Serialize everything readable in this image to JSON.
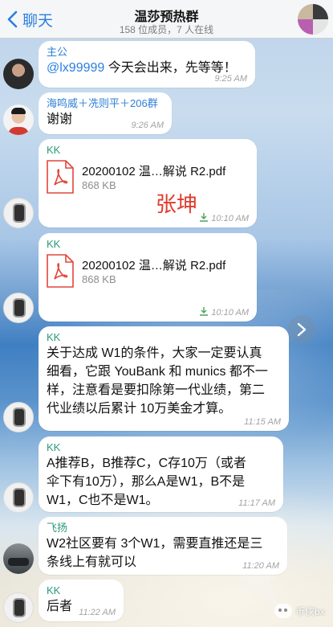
{
  "header": {
    "back_label": "聊天",
    "title": "温莎预热群",
    "subtitle": "158 位成员，7 人在线"
  },
  "messages": [
    {
      "sender": "主公",
      "mention": "@lx99999",
      "text": " 今天会出来，先等等！",
      "time": "9:25 AM"
    },
    {
      "sender": "海鸣威＋冼则平＋206群",
      "text": "谢谢",
      "time": "9:26 AM"
    },
    {
      "sender": "KK",
      "file_name": "20200102 温…解说 R2.pdf",
      "file_size": "868 KB",
      "time": "10:10 AM"
    },
    {
      "sender": "KK",
      "file_name": "20200102 温…解说 R2.pdf",
      "file_size": "868 KB",
      "time": "10:10 AM"
    },
    {
      "sender": "KK",
      "lines": [
        "关于达成 W1的条件，大家一定要认真",
        "细看，它跟 YouBank 和 munics 都不一",
        "样，注意看是要扣除第一代业绩，第二",
        "代业绩以后累计 10万美金才算。"
      ],
      "time": "11:15 AM"
    },
    {
      "sender": "KK",
      "lines": [
        "A推荐B，B推荐C，C存10万（或者",
        "伞下有10万），那么A是W1，B不是",
        "W1，C也不是W1。"
      ],
      "time": "11:17 AM"
    },
    {
      "sender": "飞扬",
      "lines": [
        "W2社区要有 3个W1，需要直推还是三",
        "条线上有就可以"
      ],
      "time": "11:20 AM"
    },
    {
      "sender": "KK",
      "text": "后者",
      "time": "11:22 AM"
    }
  ],
  "overlay": {
    "watermark_name": "张坤",
    "wechat_tag": "币侠bx"
  },
  "colors": {
    "accent": "#2a7fe0",
    "pdf_red": "#e0463a",
    "bubble": "#ffffff"
  },
  "icons": {
    "back": "chevron-left-icon",
    "file": "pdf-file-icon",
    "downloaded": "download-arrow-icon",
    "forward": "forward-arrow-icon"
  }
}
